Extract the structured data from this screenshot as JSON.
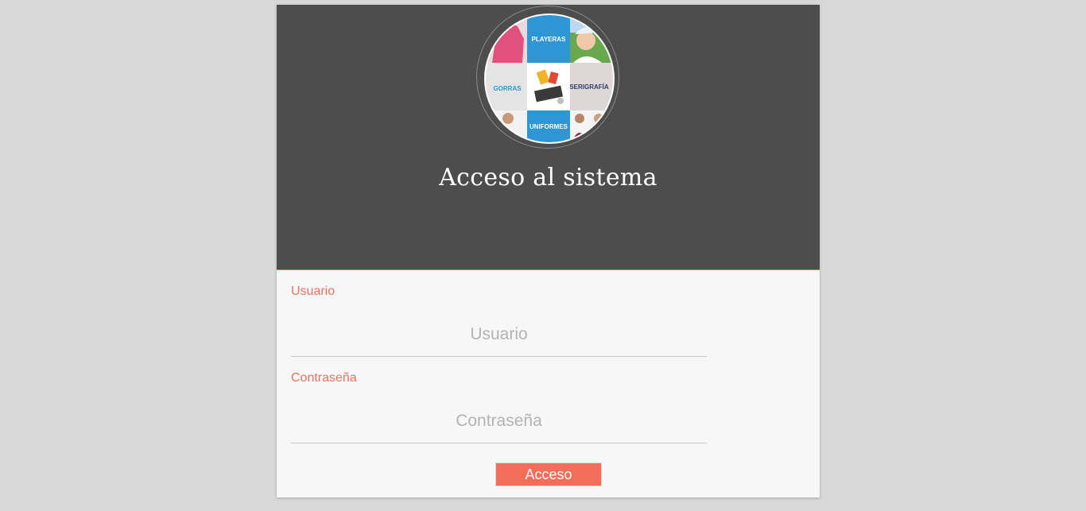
{
  "header": {
    "title": "Acceso al sistema",
    "logo": {
      "top": "PLAYERAS",
      "left": "GORRAS",
      "right": "SERIGRAFÍA",
      "bottom": "UNIFORMES"
    }
  },
  "form": {
    "username_label": "Usuario",
    "username_placeholder": "Usuario",
    "password_label": "Contraseña",
    "password_placeholder": "Contraseña",
    "submit_label": "Acceso"
  },
  "colors": {
    "background": "#d8d8d8",
    "header": "#4d4d4d",
    "accent": "#e8735f",
    "button": "#f26e58",
    "tile_blue": "#2e96d5"
  }
}
